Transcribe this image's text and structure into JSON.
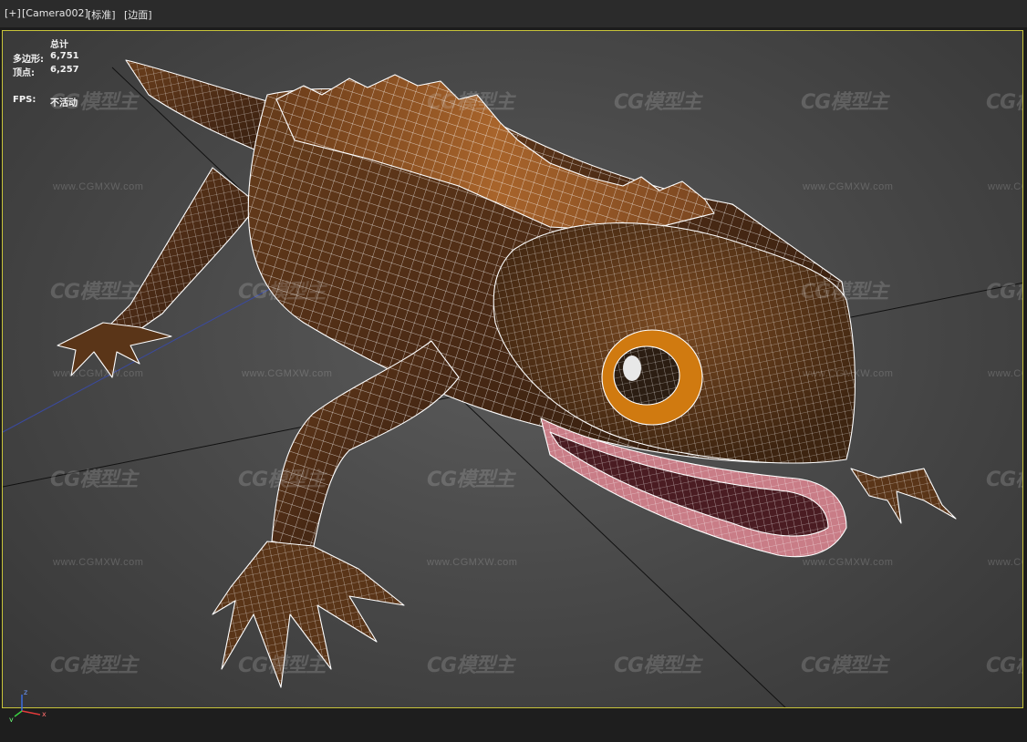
{
  "viewport_labels": {
    "plus": "[+]",
    "camera": "[Camera002]",
    "shading": "[标准]",
    "edges": "[边面]"
  },
  "statistics": {
    "total_label": "总计",
    "polygons_label": "多边形:",
    "polygons_value": "6,751",
    "vertices_label": "顶点:",
    "vertices_value": "6,257",
    "fps_label": "FPS:",
    "fps_value": "不活动"
  },
  "watermark": {
    "logo_text": "CG模型主",
    "url_text": "www.CGMXW.com"
  },
  "gizmo": {
    "x_label": "x",
    "y_label": "y",
    "z_label": "z"
  },
  "colors": {
    "viewport_border": "#c8c43a",
    "wire": "#ffffff",
    "lizard_body": "#4a2a15",
    "lizard_back": "#9a5a25",
    "mouth": "#c97d87",
    "eye_ring": "#d07a10"
  },
  "icons": {
    "axis": "axis-tripod-icon"
  }
}
